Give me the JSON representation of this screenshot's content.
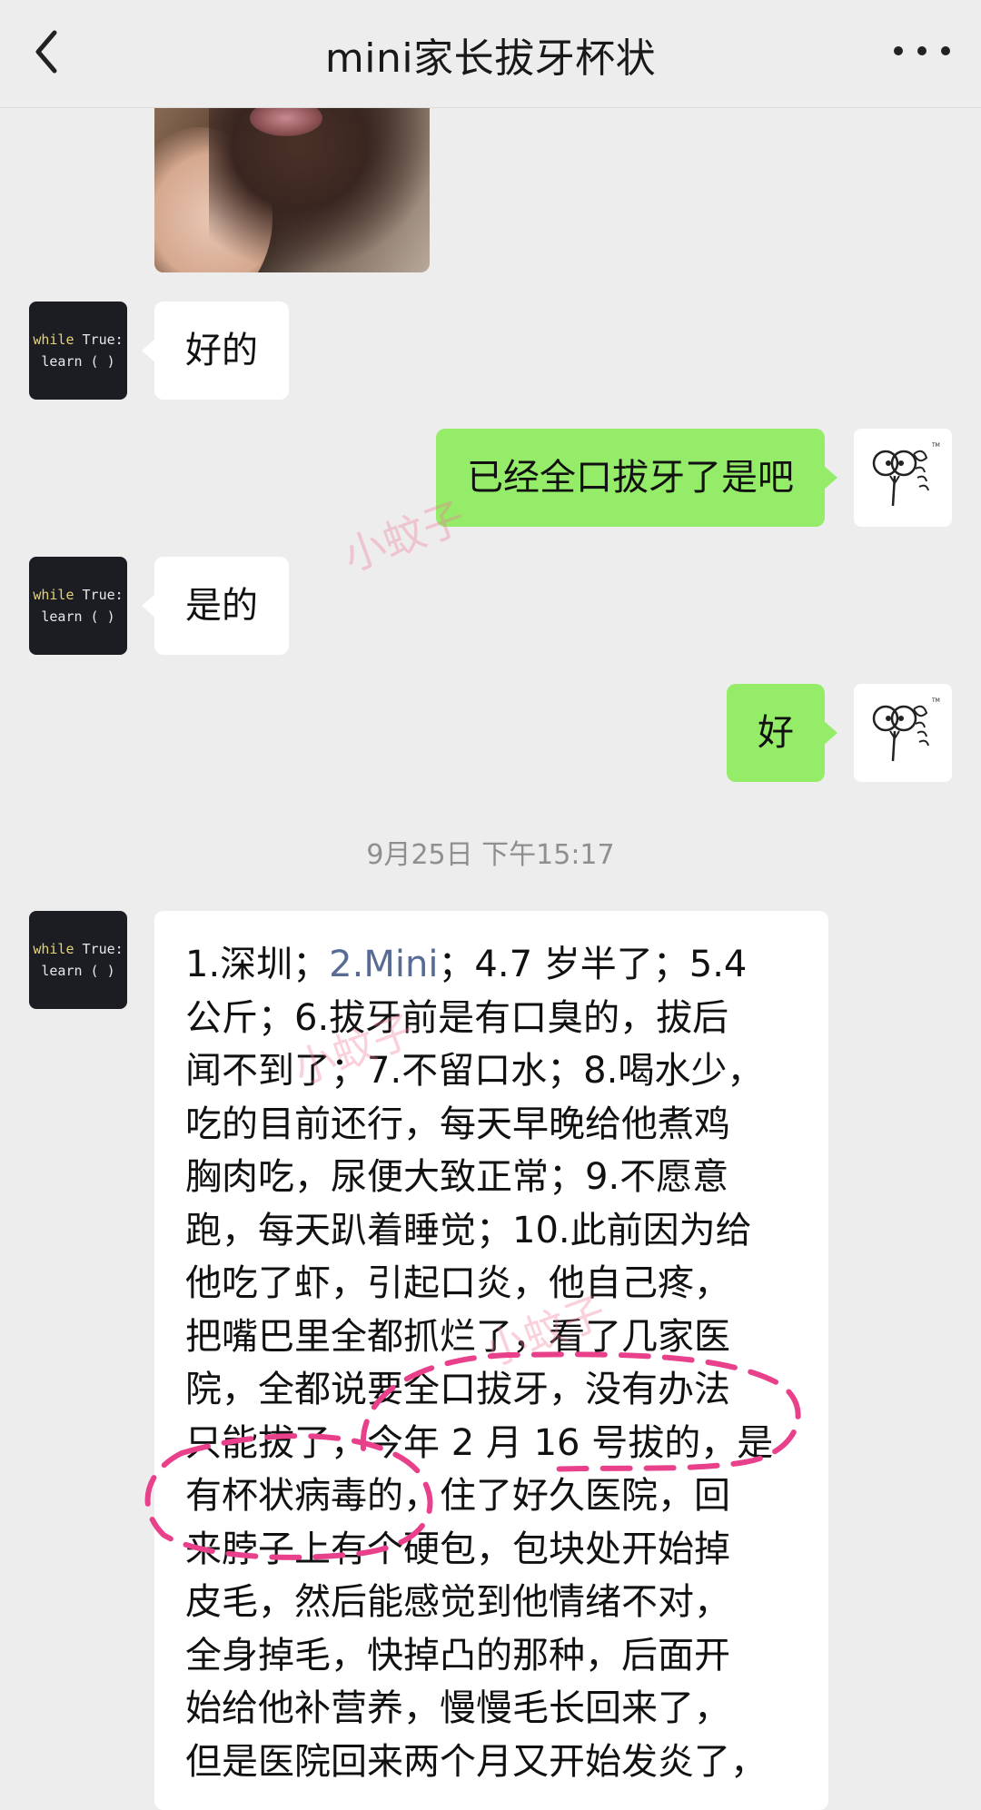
{
  "header": {
    "title": "mini家长拔牙杯状",
    "back_icon": "chevron-left-icon",
    "more_icon": "more-dots-icon"
  },
  "messages": [
    {
      "side": "left",
      "text": "好的"
    },
    {
      "side": "right",
      "text": "已经全口拔牙了是吧"
    },
    {
      "side": "left",
      "text": "是的"
    },
    {
      "side": "right",
      "text": "好"
    }
  ],
  "timestamp": "9月25日 下午15:17",
  "long_message": {
    "lines": [
      {
        "before": "1.深圳；",
        "link": "2.Mini",
        "after": "；4.7 岁半了；5.4"
      },
      {
        "before": "公斤；6.拔牙前是有口臭的，拔后"
      },
      {
        "before": "闻不到了；7.不留口水；8.喝水少，"
      },
      {
        "before": "吃的目前还行，每天早晚给他煮鸡"
      },
      {
        "before": "胸肉吃，尿便大致正常；9.不愿意"
      },
      {
        "before": "跑，每天趴着睡觉；10.此前因为给"
      },
      {
        "before": "他吃了虾，引起口炎，他自己疼，"
      },
      {
        "before": "把嘴巴里全都抓烂了，看了几家医"
      },
      {
        "before": "院，全都说要全口拔牙，没有办法"
      },
      {
        "before": "只能拔了，今年 2 月 16 号拔的，是"
      },
      {
        "before": "有杯状病毒的，住了好久医院，回"
      },
      {
        "before": "来脖子上有个硬包，包块处开始掉"
      },
      {
        "before": "皮毛，然后能感觉到他情绪不对，"
      },
      {
        "before": "全身掉毛，快掉凸的那种，后面开"
      },
      {
        "before": "始给他补营养，慢慢毛长回来了，"
      },
      {
        "before": "但是医院回来两个月又开始发炎了，"
      }
    ]
  },
  "avatar_left": {
    "line1_kw": "while",
    "line1_rest": " True:",
    "line2": "learn ( )"
  },
  "watermark": "小蚊子",
  "colors": {
    "background": "#ededed",
    "sent_bubble": "#95ec69",
    "received_bubble": "#ffffff",
    "link": "#576b95",
    "annotation": "#e8408a"
  }
}
